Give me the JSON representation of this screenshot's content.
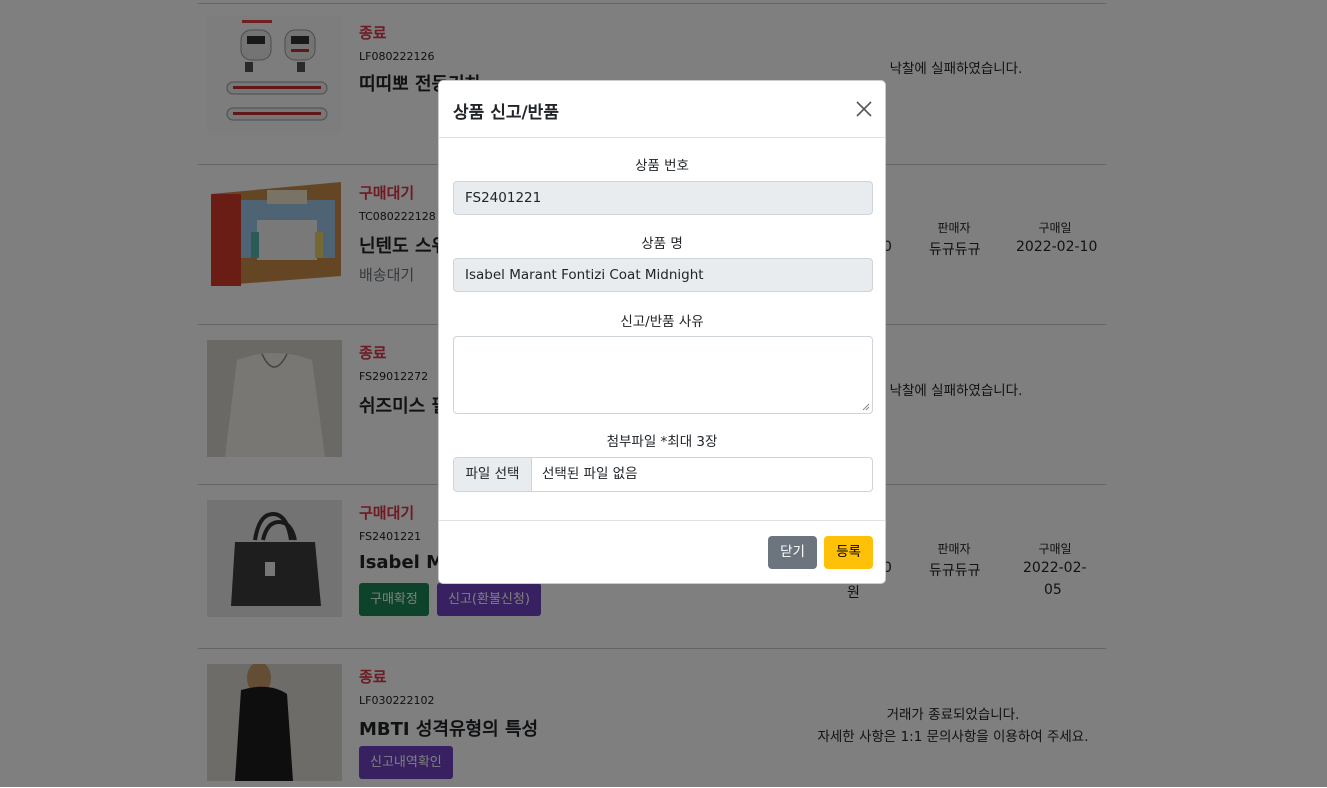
{
  "orders": [
    {
      "status": "종료",
      "code": "LF080222126",
      "name": "띠띠뽀 전동기차",
      "message": "낙찰에 실패하였습니다."
    },
    {
      "status": "구매대기",
      "code": "TC080222128",
      "name": "닌텐도 스위",
      "shipping": "배송대기",
      "price_tail": "0",
      "seller_label": "판매자",
      "seller": "듀규듀규",
      "date_label": "구매일",
      "date": "2022-02-10"
    },
    {
      "status": "종료",
      "code": "FS29012272",
      "name": "쉬즈미스 필",
      "message": "낙찰에 실패하였습니다."
    },
    {
      "status": "구매대기",
      "code": "FS2401221",
      "name": "Isabel Ma",
      "confirm_btn": "구매확정",
      "report_btn": "신고(환불신청)",
      "price_tail": "0",
      "price_unit": "원",
      "seller_label": "판매자",
      "seller": "듀규듀규",
      "date_label": "구매일",
      "date_line1": "2022-02-",
      "date_line2": "05"
    },
    {
      "status": "종료",
      "code": "LF030222102",
      "name": "MBTI 성격유형의 특성",
      "history_btn": "신고내역확인",
      "message_line1": "거래가 종료되었습니다.",
      "message_line2": "자세한 사항은 1:1 문의사항을 이용하여 주세요."
    }
  ],
  "modal": {
    "title": "상품 신고/반품",
    "product_no_label": "상품 번호",
    "product_no_value": "FS2401221",
    "product_name_label": "상품 명",
    "product_name_value": "Isabel Marant Fontizi Coat Midnight",
    "reason_label": "신고/반품 사유",
    "reason_value": "",
    "attach_label": "첨부파일 *최대 3장",
    "file_button": "파일 선택",
    "file_status": "선택된 파일 없음",
    "close_button": "닫기",
    "submit_button": "등록"
  },
  "colors": {
    "status_red": "#dc3545",
    "confirm_green": "#198754",
    "report_purple": "#6f42c1",
    "submit_yellow": "#ffc107",
    "close_gray": "#6c757d"
  }
}
